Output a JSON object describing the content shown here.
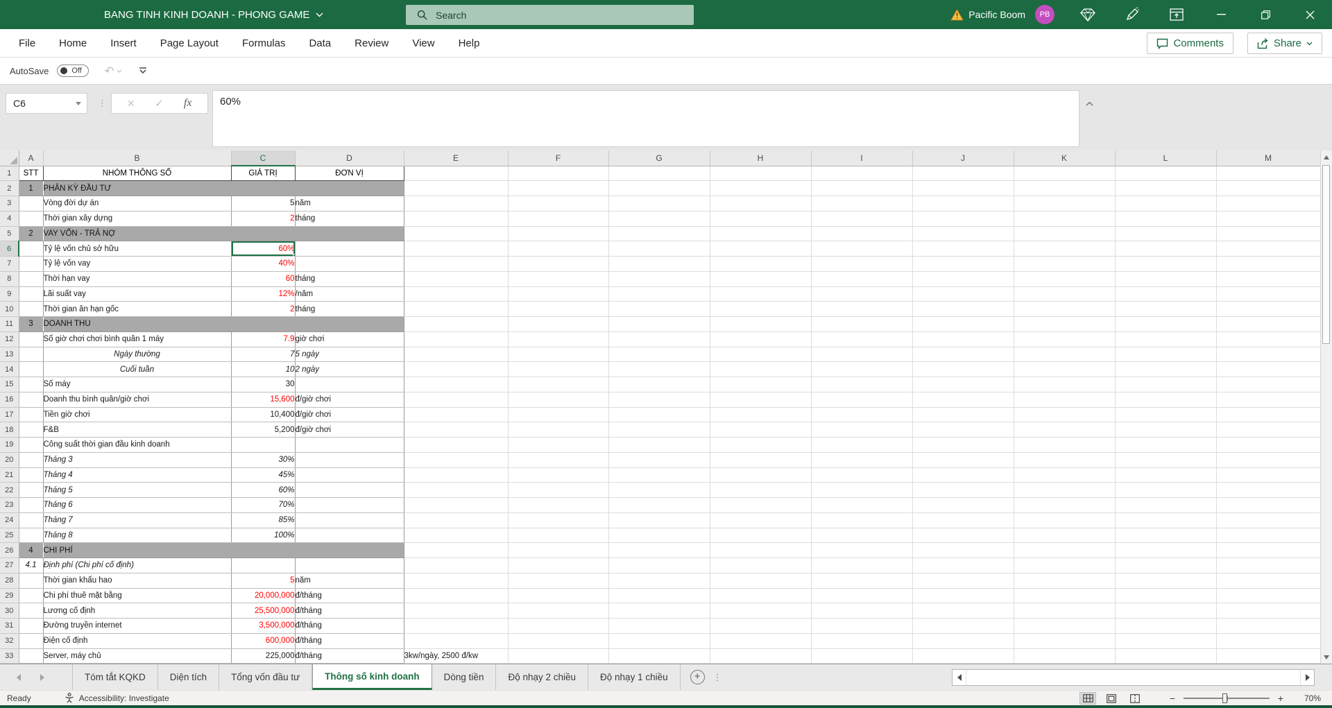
{
  "colors": {
    "title_bar_green": "#1b6a41",
    "accent_green": "#1f7244",
    "value_red": "#ff0000",
    "section_gray": "#a9a9a9",
    "avatar_magenta": "#c44ec0",
    "warning_yellow": "#f5c242"
  },
  "icons": {
    "cancel": "×",
    "enter": "✓",
    "fx": "fx",
    "undo": "↶",
    "dots_vertical": "⋮",
    "add_sheet": "+",
    "zoom_out": "−",
    "zoom_in": "+"
  },
  "title_bar": {
    "document_title": "BANG TINH KINH DOANH - PHONG GAME",
    "search_placeholder": "Search",
    "account_name": "Pacific Boom",
    "avatar_initials": "PB"
  },
  "ribbon": {
    "tabs": [
      "File",
      "Home",
      "Insert",
      "Page Layout",
      "Formulas",
      "Data",
      "Review",
      "View",
      "Help"
    ],
    "comments_label": "Comments",
    "share_label": "Share"
  },
  "quick_access": {
    "autosave_label": "AutoSave",
    "autosave_state": "Off"
  },
  "formula_bar": {
    "name_box": "C6",
    "formula": "60%"
  },
  "grid": {
    "selected_cell": "C6",
    "selected_column": "C",
    "selected_row": "6",
    "column_headers": [
      "A",
      "B",
      "C",
      "D",
      "E",
      "F",
      "G",
      "H",
      "I",
      "J",
      "K",
      "L",
      "M"
    ],
    "rows": [
      {
        "n": "1",
        "a": "STT",
        "b": "NHÓM THÔNG SỐ",
        "c": "GIÁ TRỊ",
        "d": "ĐƠN VỊ",
        "style": "head"
      },
      {
        "n": "2",
        "a": "1",
        "b": "PHÂN KỲ ĐẦU TƯ",
        "style": "section"
      },
      {
        "n": "3",
        "b": "Vòng đời dự án",
        "c": "5",
        "d": "năm",
        "style": "plain"
      },
      {
        "n": "4",
        "b": "Thời gian xây dựng",
        "c": "2",
        "d": "tháng",
        "style": "red"
      },
      {
        "n": "5",
        "a": "2",
        "b": "VAY VỐN - TRẢ NỢ",
        "style": "section"
      },
      {
        "n": "6",
        "b": "Tỷ lệ vốn chủ sở hữu",
        "c": "60%",
        "d": "",
        "style": "selected"
      },
      {
        "n": "7",
        "b": "Tỷ lệ vốn vay",
        "c": "40%",
        "style": "red"
      },
      {
        "n": "8",
        "b": "Thời hạn vay",
        "c": "60",
        "d": "tháng",
        "style": "red"
      },
      {
        "n": "9",
        "b": "Lãi suất vay",
        "c": "12%",
        "d": "/năm",
        "style": "red"
      },
      {
        "n": "10",
        "b": "Thời gian ân hạn gốc",
        "c": "2",
        "d": "tháng",
        "style": "red"
      },
      {
        "n": "11",
        "a": "3",
        "b": "DOANH THU",
        "style": "section"
      },
      {
        "n": "12",
        "b": "Số giờ chơi chơi bình quân 1 máy",
        "c": "7.9",
        "d": "giờ chơi",
        "style": "red"
      },
      {
        "n": "13",
        "b": "Ngày thường",
        "c": "7",
        "d": "5 ngày",
        "style": "itcenter"
      },
      {
        "n": "14",
        "b": "Cuối tuần",
        "c": "10",
        "d": "2 ngày",
        "style": "itcenter"
      },
      {
        "n": "15",
        "b": "Số máy",
        "c": "30",
        "style": "plain"
      },
      {
        "n": "16",
        "b": "Doanh thu bình quân/giờ chơi",
        "c": "15,600",
        "d": "đ/giờ chơi",
        "style": "redgap"
      },
      {
        "n": "17",
        "b": "Tiền giờ chơi",
        "c": "10,400",
        "d": "đ/giờ chơi",
        "style": "indent"
      },
      {
        "n": "18",
        "b": "F&B",
        "c": "5,200",
        "d": "đ/giờ chơi",
        "style": "indent"
      },
      {
        "n": "19",
        "b": "Công suất thời gian đầu kinh doanh",
        "style": "plain"
      },
      {
        "n": "20",
        "b": "Tháng 3",
        "c": "30%",
        "style": "month"
      },
      {
        "n": "21",
        "b": "Tháng 4",
        "c": "45%",
        "style": "month"
      },
      {
        "n": "22",
        "b": "Tháng 5",
        "c": "60%",
        "style": "month"
      },
      {
        "n": "23",
        "b": "Tháng 6",
        "c": "70%",
        "style": "month"
      },
      {
        "n": "24",
        "b": "Tháng 7",
        "c": "85%",
        "style": "month"
      },
      {
        "n": "25",
        "b": "Tháng 8",
        "c": "100%",
        "style": "month"
      },
      {
        "n": "26",
        "a": "4",
        "b": "CHI PHÍ",
        "style": "section"
      },
      {
        "n": "27",
        "a": "4.1",
        "b": "Định phí (Chi phí cố định)",
        "style": "bolditalic"
      },
      {
        "n": "28",
        "b": "Thời gian khấu hao",
        "c": "5",
        "d": "năm",
        "style": "red"
      },
      {
        "n": "29",
        "b": "Chi phí thuê mặt bằng",
        "c": "20,000,000",
        "d": "đ/tháng",
        "style": "red"
      },
      {
        "n": "30",
        "b": "Lương cố định",
        "c": "25,500,000",
        "d": "đ/tháng",
        "style": "red"
      },
      {
        "n": "31",
        "b": "Đường truyền internet",
        "c": "3,500,000",
        "d": "đ/tháng",
        "style": "red"
      },
      {
        "n": "32",
        "b": "Điện cố định",
        "c": "600,000",
        "d": "đ/tháng",
        "style": "red"
      },
      {
        "n": "33",
        "b": "Server, máy chủ",
        "c": "225,000",
        "d": "đ/tháng",
        "e": "3kw/ngày, 2500 đ/kw",
        "style": "indent"
      }
    ]
  },
  "sheet_tabs": {
    "tabs": [
      "Tóm tắt KQKD",
      "Diện tích",
      "Tổng vốn đầu tư",
      "Thông số kinh doanh",
      "Dòng tiền",
      "Độ nhạy 2 chiều",
      "Độ nhạy 1 chiều"
    ],
    "active_tab": "Thông số kinh doanh"
  },
  "status_bar": {
    "ready_label": "Ready",
    "accessibility_label": "Accessibility: Investigate",
    "zoom_level": "70%"
  }
}
